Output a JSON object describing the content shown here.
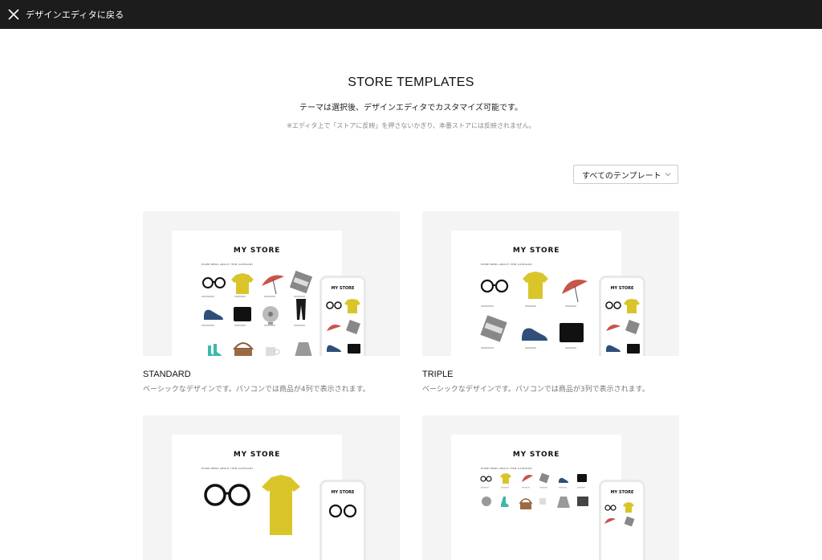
{
  "header": {
    "back_label": "デザインエディタに戻る"
  },
  "main": {
    "title": "STORE TEMPLATES",
    "subtitle": "テーマは選択後、デザインエディタでカスタマイズ可能です。",
    "note": "※エディタ上で「ストアに反映」を押さないかぎり、本番ストアには反映されません。",
    "filter": {
      "selected": "すべてのテンプレート"
    }
  },
  "templates": [
    {
      "name": "STANDARD",
      "desc": "ベーシックなデザインです。パソコンでは商品が4列で表示されます。",
      "brand": "MY STORE",
      "nav": "HOME   NEWS   ABOUT   ITEM   CATEGORY"
    },
    {
      "name": "TRIPLE",
      "desc": "ベーシックなデザインです。パソコンでは商品が3列で表示されます。",
      "brand": "MY STORE",
      "nav": "HOME   NEWS   ABOUT   ITEM   CATEGORY"
    },
    {
      "name": "",
      "desc": "",
      "brand": "MY STORE",
      "nav": "HOME   NEWS   ABOUT   ITEM   CATEGORY"
    },
    {
      "name": "",
      "desc": "",
      "brand": "MY STORE",
      "nav": "HOME   NEWS   ABOUT   ITEM   CATEGORY"
    }
  ],
  "phone_brand": "MY STORE",
  "colors": {
    "topbar": "#1c1c1c",
    "thumb_bg": "#f4f4f4",
    "yellow": "#d9c52a",
    "red": "#c9544a"
  }
}
